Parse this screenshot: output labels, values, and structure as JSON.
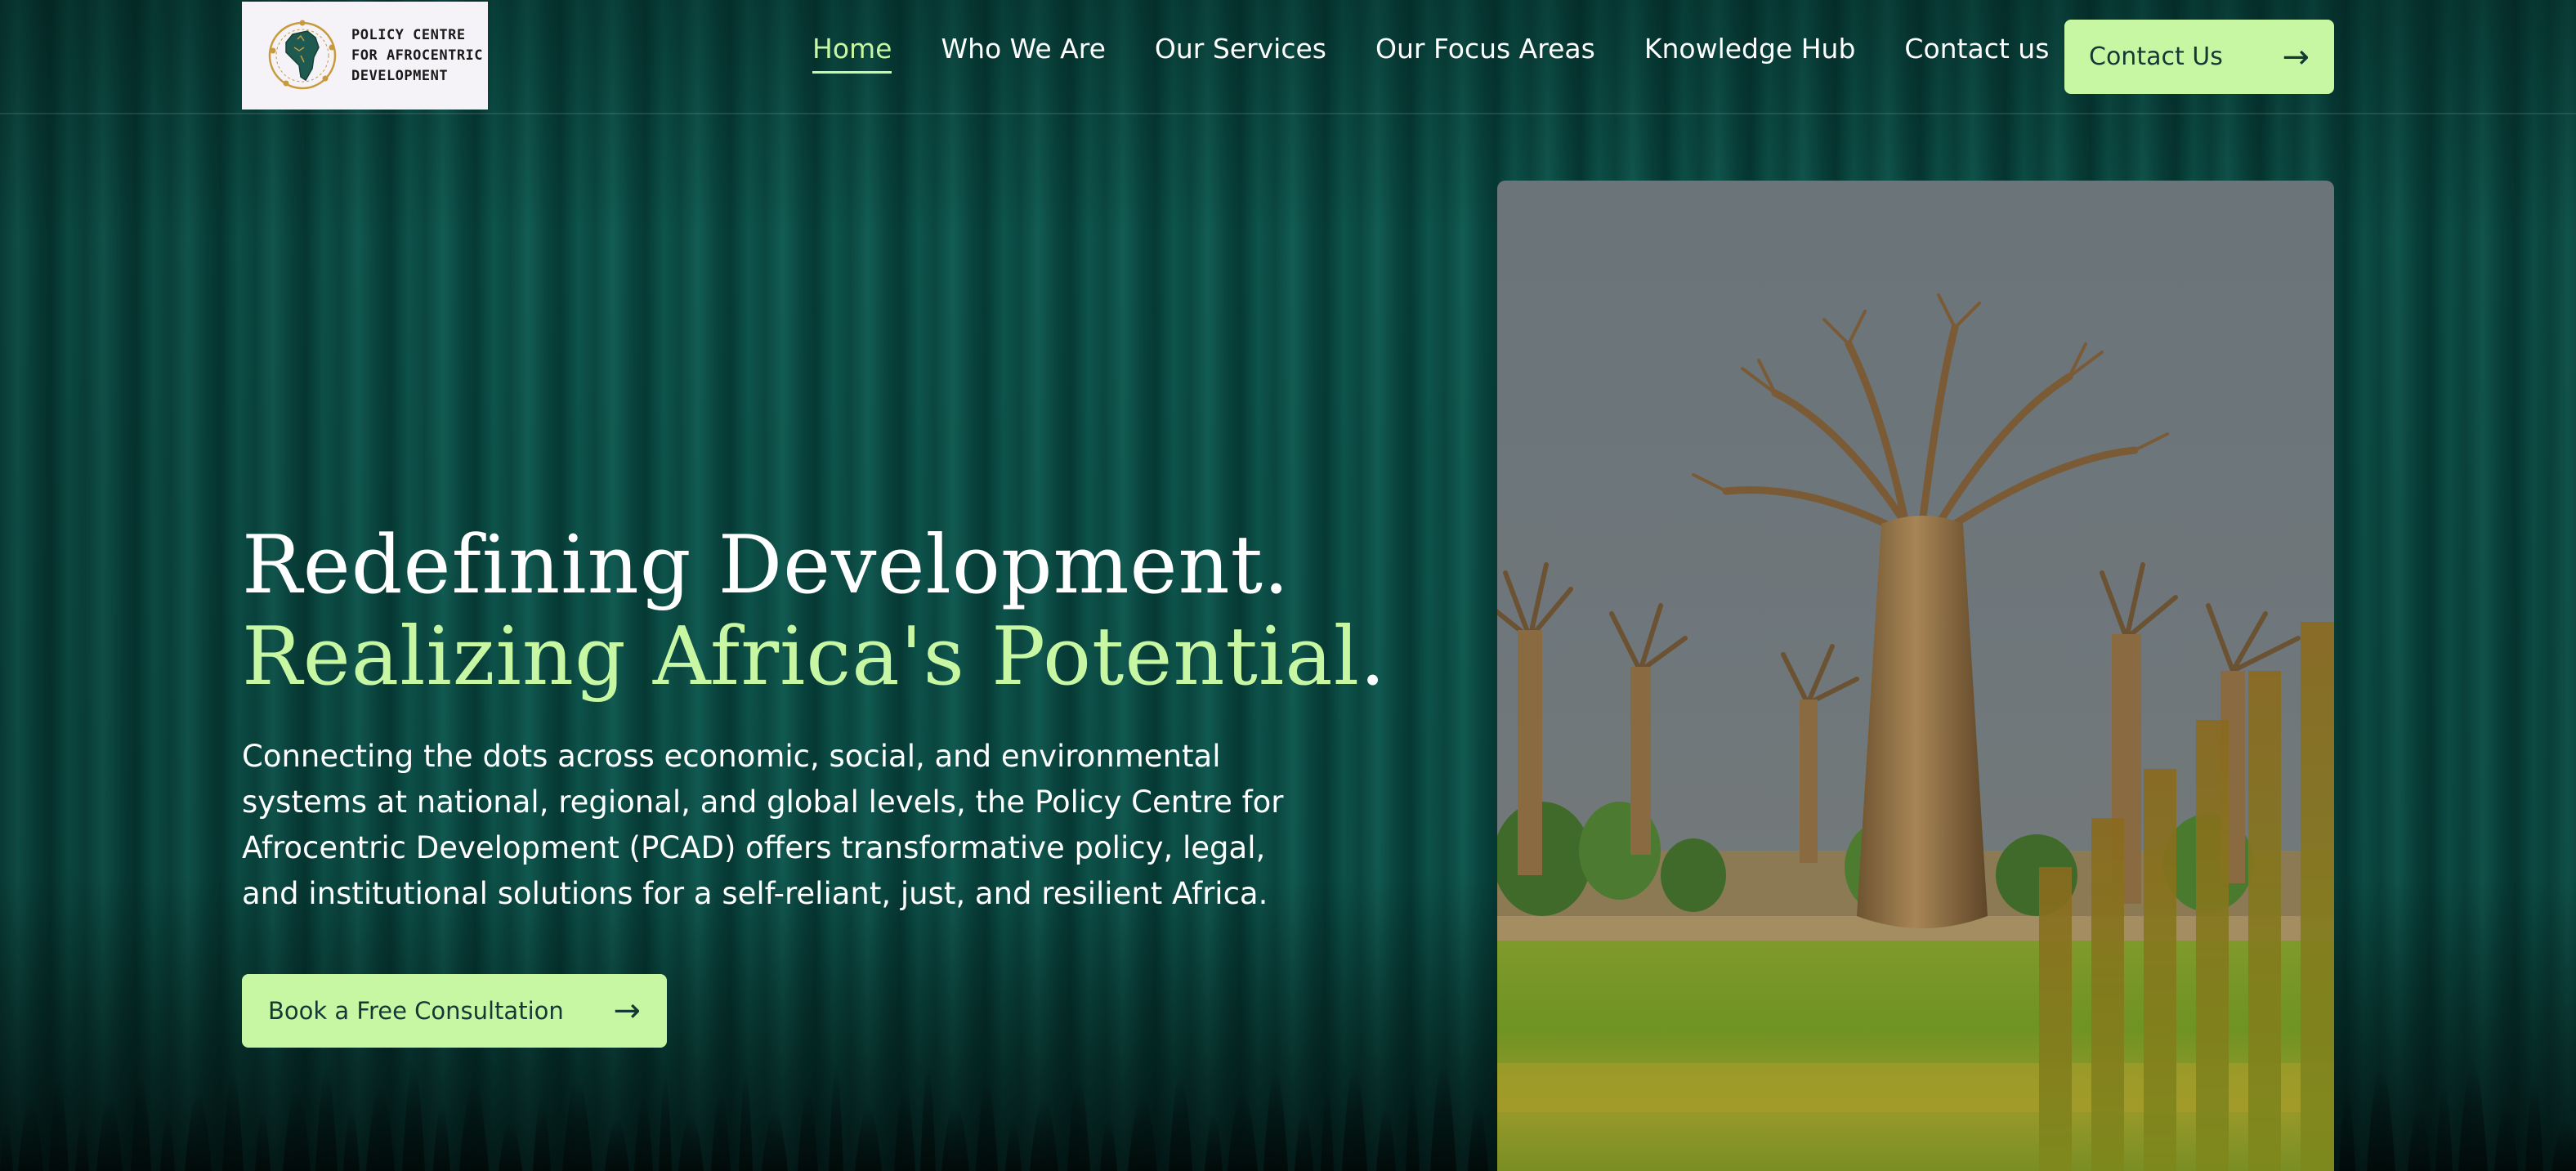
{
  "header": {
    "logo": {
      "lines": [
        "POLICY CENTRE",
        "FOR AFROCENTRIC",
        "DEVELOPMENT"
      ],
      "icon": "africa-globe-logo"
    },
    "nav": [
      {
        "label": "Home",
        "active": true
      },
      {
        "label": "Who We Are",
        "active": false
      },
      {
        "label": "Our Services",
        "active": false
      },
      {
        "label": "Our Focus Areas",
        "active": false
      },
      {
        "label": "Knowledge Hub",
        "active": false
      },
      {
        "label": "Contact us",
        "active": false
      }
    ],
    "cta": {
      "label": "Contact Us",
      "icon": "arrow-right-icon"
    }
  },
  "hero": {
    "title_line1": "Redefining Development.",
    "title_line2": "Realizing Africa's Potential",
    "title_line2_end": ".",
    "description": "Connecting the dots across economic, social, and environmental systems at national, regional, and global levels, the Policy Centre for Afrocentric Development (PCAD) offers transformative policy, legal, and institutional solutions for a self-reliant, just, and resilient Africa.",
    "cta": {
      "label": "Book a Free Consultation",
      "icon": "arrow-right-icon"
    },
    "image": {
      "subject": "baobab-trees-photo"
    }
  },
  "colors": {
    "background": "#0b4741",
    "accent": "#c8f7a4",
    "button_text": "#123a34",
    "text": "#ffffff"
  }
}
